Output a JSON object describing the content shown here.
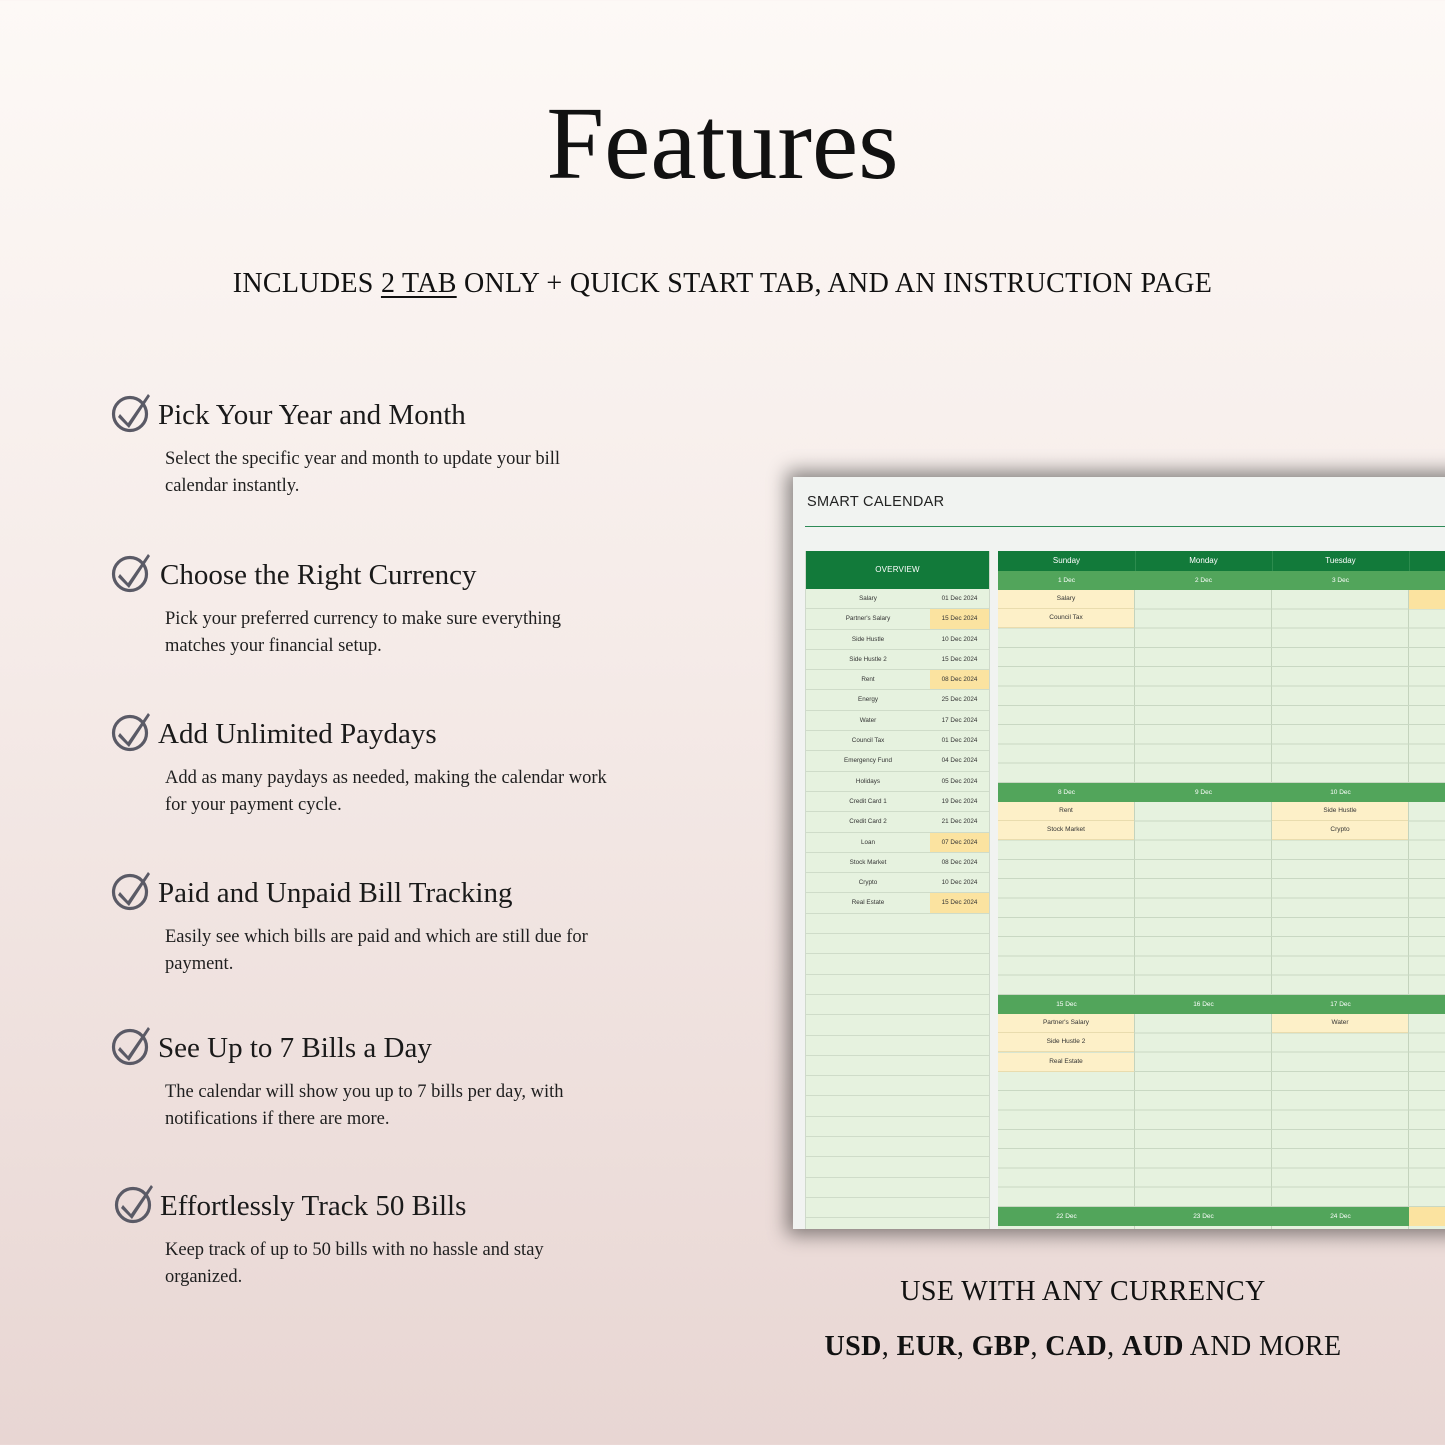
{
  "title": "Features",
  "subtitle": {
    "prefix": "INCLUDES ",
    "underlined": "2 TAB",
    "suffix": " ONLY + QUICK START TAB, AND AN INSTRUCTION PAGE"
  },
  "features": [
    {
      "heading": "Pick Your Year and Month",
      "text": "Select the specific year and month to update your bill calendar instantly."
    },
    {
      "heading": "Choose the Right Currency",
      "text": "Pick your preferred currency to make sure everything matches your financial setup."
    },
    {
      "heading": "Add Unlimited Paydays",
      "text": "Add as many paydays as needed, making the calendar work for your payment cycle."
    },
    {
      "heading": "Paid and Unpaid Bill Tracking",
      "text": "Easily see which bills are paid and which are still due for payment."
    },
    {
      "heading": "See Up to 7 Bills a Day",
      "text": "The calendar will show you up to 7 bills per day, with notifications if there are more."
    },
    {
      "heading": "Effortlessly Track 50 Bills",
      "text": "Keep track of up to 50 bills with no hassle and stay organized."
    }
  ],
  "icons": {
    "check": "check-mark-icon"
  },
  "colors": {
    "sheet_green": "#127a3a",
    "band_green": "#52a55b",
    "cell_green": "#e6f2df",
    "highlight": "#fbe3a0",
    "bill_bg": "#fdf0c8",
    "check_gray": "#5a5a66"
  },
  "sheet": {
    "title": "SMART CALENDAR",
    "overview_header": "OVERVIEW",
    "overview_rows": [
      {
        "name": "Salary",
        "date": "01 Dec 2024",
        "highlight": false
      },
      {
        "name": "Partner's Salary",
        "date": "15 Dec 2024",
        "highlight": true
      },
      {
        "name": "Side Hustle",
        "date": "10 Dec 2024",
        "highlight": false
      },
      {
        "name": "Side Hustle 2",
        "date": "15 Dec 2024",
        "highlight": false
      },
      {
        "name": "Rent",
        "date": "08 Dec 2024",
        "highlight": true
      },
      {
        "name": "Energy",
        "date": "25 Dec 2024",
        "highlight": false
      },
      {
        "name": "Water",
        "date": "17 Dec 2024",
        "highlight": false
      },
      {
        "name": "Council Tax",
        "date": "01 Dec 2024",
        "highlight": false
      },
      {
        "name": "Emergency Fund",
        "date": "04 Dec 2024",
        "highlight": false
      },
      {
        "name": "Holidays",
        "date": "05 Dec 2024",
        "highlight": false
      },
      {
        "name": "Credit Card 1",
        "date": "19 Dec 2024",
        "highlight": false
      },
      {
        "name": "Credit Card 2",
        "date": "21 Dec 2024",
        "highlight": false
      },
      {
        "name": "Loan",
        "date": "07 Dec 2024",
        "highlight": true
      },
      {
        "name": "Stock Market",
        "date": "08 Dec 2024",
        "highlight": false
      },
      {
        "name": "Crypto",
        "date": "10 Dec 2024",
        "highlight": false
      },
      {
        "name": "Real Estate",
        "date": "15 Dec 2024",
        "highlight": true
      }
    ],
    "days": [
      "Sunday",
      "Monday",
      "Tuesday"
    ],
    "weeks": [
      {
        "dates": [
          "1 Dec",
          "2 Dec",
          "3 Dec"
        ],
        "bills": [
          [
            "Salary",
            "Council Tax"
          ],
          [],
          []
        ]
      },
      {
        "dates": [
          "8 Dec",
          "9 Dec",
          "10 Dec"
        ],
        "bills": [
          [
            "Rent",
            "Stock Market"
          ],
          [],
          [
            "Side Hustle",
            "Crypto"
          ]
        ]
      },
      {
        "dates": [
          "15 Dec",
          "16 Dec",
          "17 Dec"
        ],
        "bills": [
          [
            "Partner's Salary",
            "Side Hustle 2",
            "Real Estate"
          ],
          [],
          [
            "Water"
          ]
        ]
      },
      {
        "dates": [
          "22 Dec",
          "23 Dec",
          "24 Dec"
        ],
        "bills": [
          [],
          [],
          []
        ]
      }
    ]
  },
  "currency": {
    "line1": "USE WITH ANY CURRENCY",
    "codes": [
      "USD",
      "EUR",
      "GBP",
      "CAD",
      "AUD"
    ],
    "separator": ", ",
    "suffix": " AND MORE"
  }
}
